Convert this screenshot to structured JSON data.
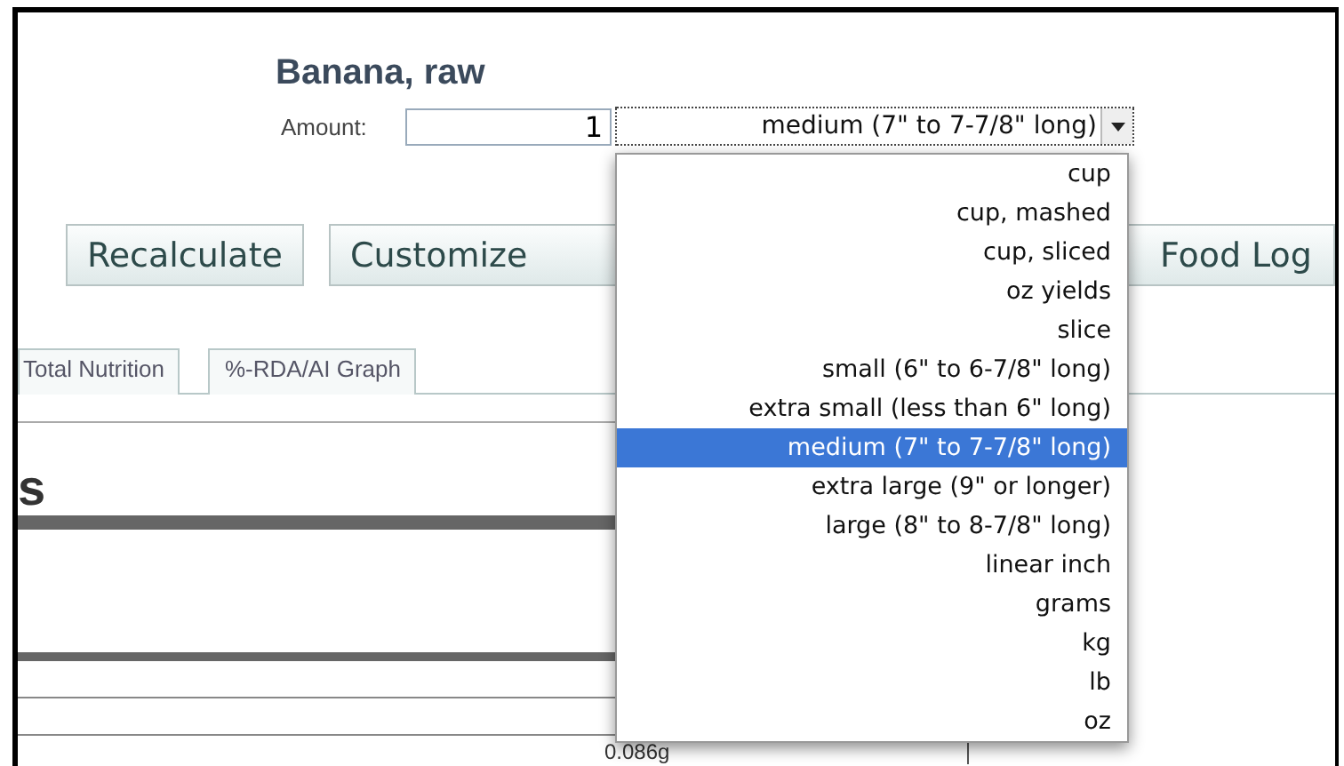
{
  "food_title": "Banana, raw",
  "amount": {
    "label": "Amount:",
    "value": "1"
  },
  "unit_select": {
    "value": "medium (7\" to 7-7/8\" long)",
    "expanded": true,
    "options": [
      {
        "label": "cup",
        "selected": false
      },
      {
        "label": "cup, mashed",
        "selected": false
      },
      {
        "label": "cup, sliced",
        "selected": false
      },
      {
        "label": "oz yields",
        "selected": false
      },
      {
        "label": "slice",
        "selected": false
      },
      {
        "label": "small (6\" to 6-7/8\" long)",
        "selected": false
      },
      {
        "label": "extra small (less than 6\" long)",
        "selected": false
      },
      {
        "label": "medium (7\" to 7-7/8\" long)",
        "selected": true
      },
      {
        "label": "extra large (9\" or longer)",
        "selected": false
      },
      {
        "label": "large (8\" to 8-7/8\" long)",
        "selected": false
      },
      {
        "label": "linear inch",
        "selected": false
      },
      {
        "label": "grams",
        "selected": false
      },
      {
        "label": "kg",
        "selected": false
      },
      {
        "label": "lb",
        "selected": false
      },
      {
        "label": "oz",
        "selected": false
      }
    ]
  },
  "buttons": [
    "Recalculate",
    "Customize",
    "Food Log"
  ],
  "tabs": [
    "Total Nutrition",
    "%-RDA/AI Graph"
  ],
  "section_heading": "s",
  "table_value": "0.086g"
}
